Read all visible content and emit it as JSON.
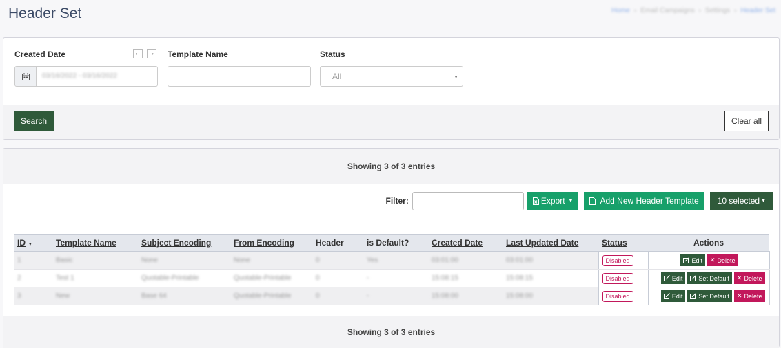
{
  "page": {
    "title": "Header Set",
    "breadcrumb": [
      "Home",
      "Email Campaigns",
      "Settings",
      "Header Set"
    ]
  },
  "search": {
    "created_date_label": "Created Date",
    "created_date_value": "03/16/2022 - 03/16/2022",
    "template_name_label": "Template Name",
    "template_name_value": "",
    "status_label": "Status",
    "status_value": "All",
    "search_button": "Search",
    "clear_button": "Clear all"
  },
  "grid": {
    "showing_top": "Showing 3 of 3 entries",
    "showing_bottom": "Showing 3 of 3 entries",
    "filter_label": "Filter:",
    "filter_value": "",
    "export_button": "Export",
    "add_button": "Add New Header Template",
    "selected_button": "10 selected",
    "columns": [
      "ID",
      "Template Name",
      "Subject Encoding",
      "From Encoding",
      "Header",
      "is Default?",
      "Created Date",
      "Last Updated Date",
      "Status",
      "Actions"
    ],
    "rows": [
      {
        "id": "1",
        "name": "Basic",
        "subject": "None",
        "from": "None",
        "header": "0",
        "default": "Yes",
        "created": "03:01:00",
        "updated": "03:01:00",
        "status": "Disabled",
        "actions": [
          "Edit",
          "Delete"
        ]
      },
      {
        "id": "2",
        "name": "Test 1",
        "subject": "Quotable-Printable",
        "from": "Quotable-Printable",
        "header": "0",
        "default": "-",
        "created": "15:08:15",
        "updated": "15:08:15",
        "status": "Disabled",
        "actions": [
          "Edit",
          "Set Default",
          "Delete"
        ]
      },
      {
        "id": "3",
        "name": "New",
        "subject": "Base 64",
        "from": "Quotable-Printable",
        "header": "0",
        "default": "-",
        "created": "15:08:00",
        "updated": "15:08:00",
        "status": "Disabled",
        "actions": [
          "Edit",
          "Set Default",
          "Delete"
        ]
      }
    ]
  }
}
